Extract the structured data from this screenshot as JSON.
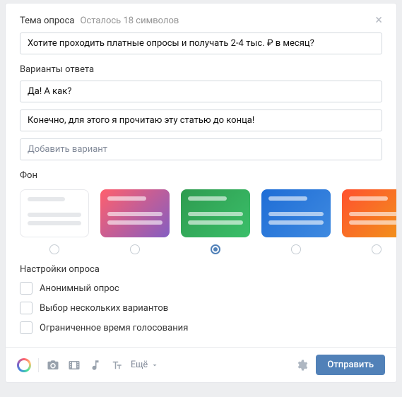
{
  "topic": {
    "label": "Тема опроса",
    "remaining": "Осталось 18 символов",
    "value": "Хотите проходить платные опросы и получать 2-4 тыс. ₽ в месяц?"
  },
  "answers": {
    "label": "Варианты ответа",
    "items": [
      "Да! А как?",
      "Конечно, для этого я прочитаю эту статью до конца!"
    ],
    "add_placeholder": "Добавить вариант"
  },
  "background": {
    "label": "Фон",
    "selected_index": 2,
    "options": [
      "white",
      "pink-purple",
      "green",
      "blue",
      "orange"
    ]
  },
  "settings": {
    "label": "Настройки опроса",
    "items": [
      "Анонимный опрос",
      "Выбор нескольких вариантов",
      "Ограниченное время голосования"
    ]
  },
  "footer": {
    "more_label": "Ещё",
    "submit_label": "Отправить"
  }
}
